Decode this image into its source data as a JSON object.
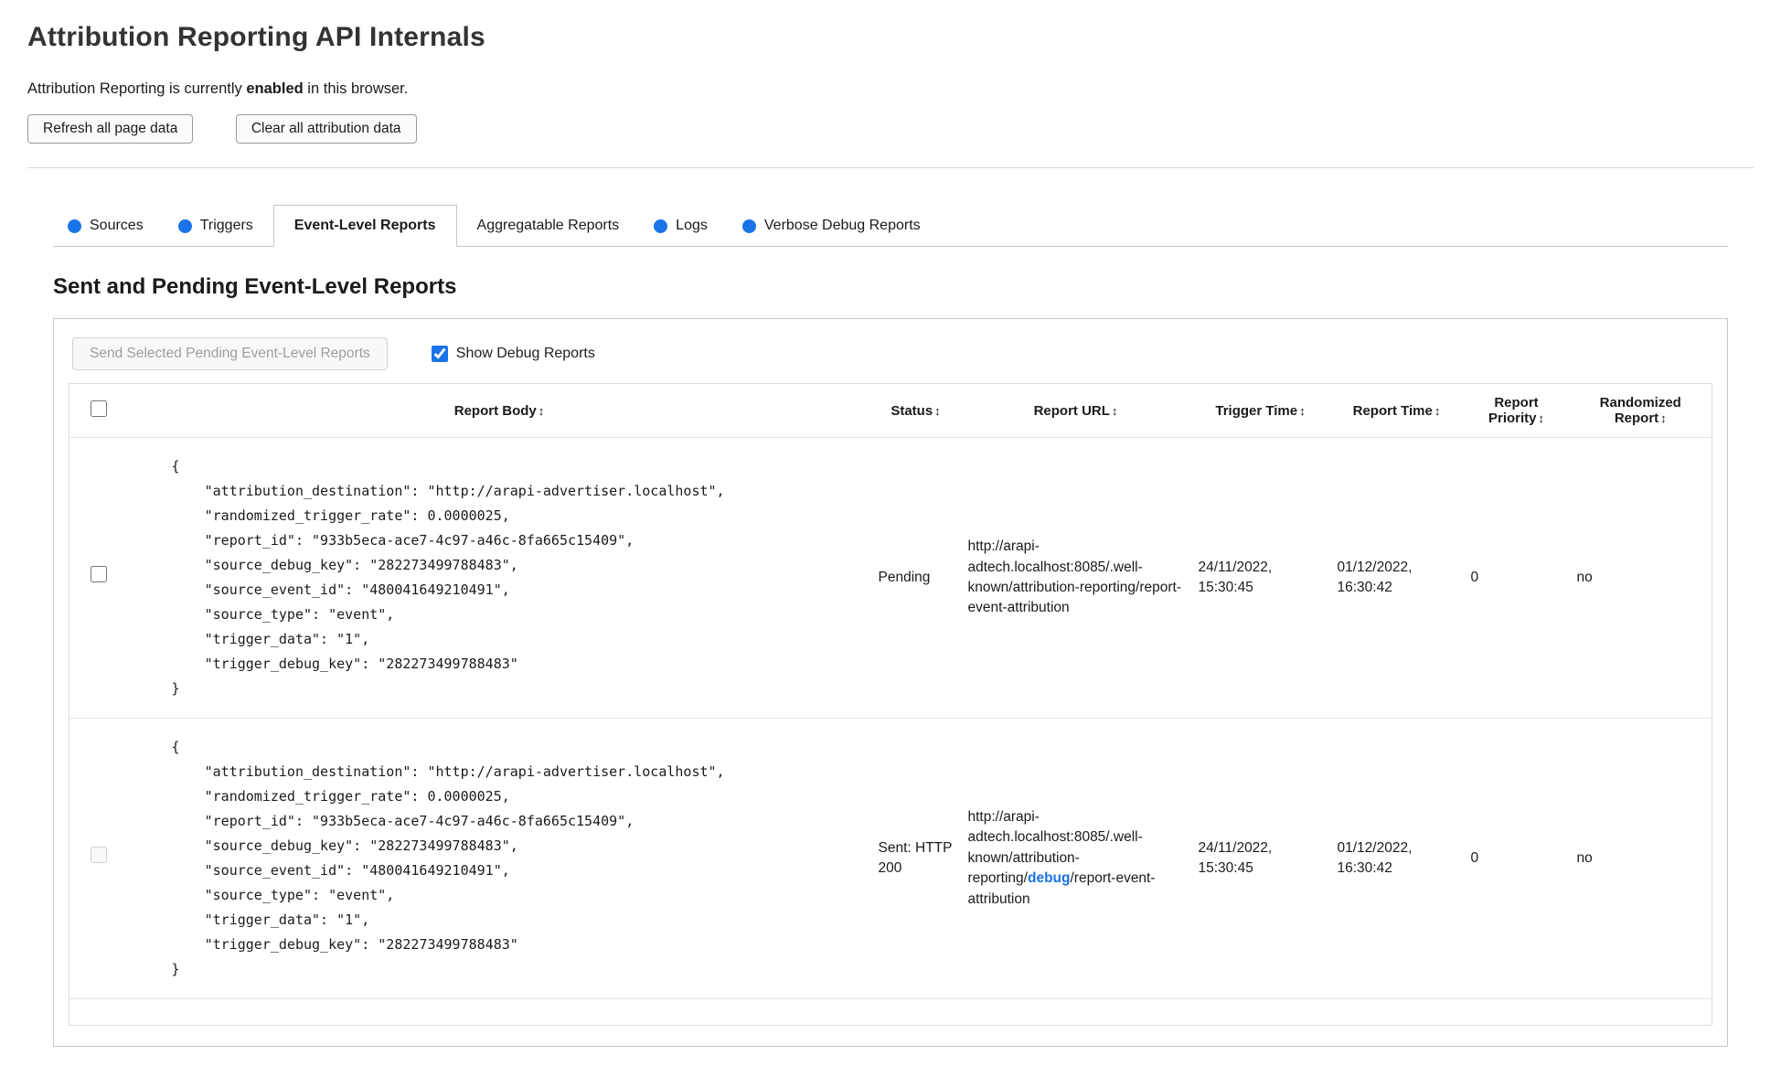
{
  "page": {
    "title": "Attribution Reporting API Internals",
    "status": {
      "prefix": "Attribution Reporting is currently ",
      "bold": "enabled",
      "suffix": " in this browser."
    },
    "buttons": {
      "refresh": "Refresh all page data",
      "clear": "Clear all attribution data"
    }
  },
  "tabs": [
    {
      "label": "Sources",
      "has_dot": true,
      "active": false
    },
    {
      "label": "Triggers",
      "has_dot": true,
      "active": false
    },
    {
      "label": "Event-Level Reports",
      "has_dot": false,
      "active": true
    },
    {
      "label": "Aggregatable Reports",
      "has_dot": false,
      "active": false
    },
    {
      "label": "Logs",
      "has_dot": true,
      "active": false
    },
    {
      "label": "Verbose Debug Reports",
      "has_dot": true,
      "active": false
    }
  ],
  "section": {
    "heading": "Sent and Pending Event-Level Reports",
    "send_button": "Send Selected Pending Event-Level Reports",
    "show_debug_label": "Show Debug Reports"
  },
  "table": {
    "sort_icon": "↕",
    "headers": [
      "Report Body",
      "Status",
      "Report URL",
      "Trigger Time",
      "Report Time",
      "Report Priority",
      "Randomized Report"
    ],
    "rows": [
      {
        "body": "{\n    \"attribution_destination\": \"http://arapi-advertiser.localhost\",\n    \"randomized_trigger_rate\": 0.0000025,\n    \"report_id\": \"933b5eca-ace7-4c97-a46c-8fa665c15409\",\n    \"source_debug_key\": \"282273499788483\",\n    \"source_event_id\": \"480041649210491\",\n    \"source_type\": \"event\",\n    \"trigger_data\": \"1\",\n    \"trigger_debug_key\": \"282273499788483\"\n}",
        "status": "Pending",
        "url_pre": "http://arapi-adtech.localhost:8085/.well-known/attribution-reporting/report-event-attribution",
        "url_debug": "",
        "url_post": "",
        "trigger_time": "24/11/2022, 15:30:45",
        "report_time": "01/12/2022, 16:30:42",
        "priority": "0",
        "randomized": "no"
      },
      {
        "body": "{\n    \"attribution_destination\": \"http://arapi-advertiser.localhost\",\n    \"randomized_trigger_rate\": 0.0000025,\n    \"report_id\": \"933b5eca-ace7-4c97-a46c-8fa665c15409\",\n    \"source_debug_key\": \"282273499788483\",\n    \"source_event_id\": \"480041649210491\",\n    \"source_type\": \"event\",\n    \"trigger_data\": \"1\",\n    \"trigger_debug_key\": \"282273499788483\"\n}",
        "status": "Sent: HTTP 200",
        "url_pre": "http://arapi-adtech.localhost:8085/.well-known/attribution-reporting/",
        "url_debug": "debug",
        "url_post": "/report-event-attribution",
        "trigger_time": "24/11/2022, 15:30:45",
        "report_time": "01/12/2022, 16:30:42",
        "priority": "0",
        "randomized": "no"
      }
    ]
  },
  "colors": {
    "accent_blue": "#1a73e8"
  }
}
